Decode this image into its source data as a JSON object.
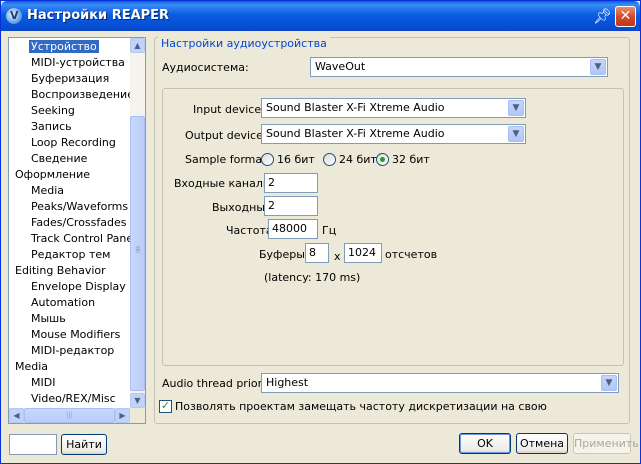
{
  "window": {
    "title": "Настройки REAPER",
    "icon_letter": "V"
  },
  "tree": {
    "items": [
      {
        "label": "Устройство",
        "level": 1,
        "selected": true
      },
      {
        "label": "MIDI-устройства",
        "level": 1
      },
      {
        "label": "Буферизация",
        "level": 1
      },
      {
        "label": "Воспроизведение",
        "level": 1
      },
      {
        "label": "Seeking",
        "level": 1
      },
      {
        "label": "Запись",
        "level": 1
      },
      {
        "label": "Loop Recording",
        "level": 1
      },
      {
        "label": "Сведение",
        "level": 1
      },
      {
        "label": "Оформление",
        "level": 0
      },
      {
        "label": "Media",
        "level": 1
      },
      {
        "label": "Peaks/Waveforms",
        "level": 1
      },
      {
        "label": "Fades/Crossfades",
        "level": 1
      },
      {
        "label": "Track Control Panels",
        "level": 1
      },
      {
        "label": "Редактор тем",
        "level": 1
      },
      {
        "label": "Editing Behavior",
        "level": 0
      },
      {
        "label": "Envelope Display",
        "level": 1
      },
      {
        "label": "Automation",
        "level": 1
      },
      {
        "label": "Мышь",
        "level": 1
      },
      {
        "label": "Mouse Modifiers",
        "level": 1
      },
      {
        "label": "MIDI-редактор",
        "level": 1
      },
      {
        "label": "Media",
        "level": 0
      },
      {
        "label": "MIDI",
        "level": 1
      },
      {
        "label": "Video/REX/Misc",
        "level": 1
      }
    ]
  },
  "settings": {
    "group_title": "Настройки аудиоустройства",
    "audio_system_label": "Аудиосистема:",
    "audio_system_value": "WaveOut",
    "input_device_label": "Input device:",
    "input_device_value": "Sound Blaster X-Fi Xtreme Audio",
    "output_device_label": "Output device:",
    "output_device_value": "Sound Blaster X-Fi Xtreme Audio",
    "sample_format_label": "Sample format:",
    "sample_formats": [
      {
        "label": "16 бит",
        "selected": false
      },
      {
        "label": "24 бит",
        "selected": false
      },
      {
        "label": "32 бит",
        "selected": true
      }
    ],
    "input_channels_label": "Входные каналы:",
    "input_channels_value": "2",
    "output_channels_label": "Выходные",
    "output_channels_value": "2",
    "rate_label": "Частота",
    "rate_value": "48000",
    "rate_unit": "Гц",
    "buffers_label": "Буферы:",
    "buffers_count": "8",
    "buffers_x": "x",
    "buffers_size": "1024",
    "buffers_unit": "отсчетов",
    "latency": "(latency: 170 ms)",
    "thread_priority_label": "Audio thread priority:",
    "thread_priority_value": "Highest",
    "allow_projects_label": "Позволять проектам замещать частоту дискретизации на свою",
    "allow_projects_checked": true
  },
  "footer": {
    "search_value": "",
    "find_label": "Найти",
    "ok_label": "OK",
    "cancel_label": "Отмена",
    "apply_label": "Применить"
  }
}
